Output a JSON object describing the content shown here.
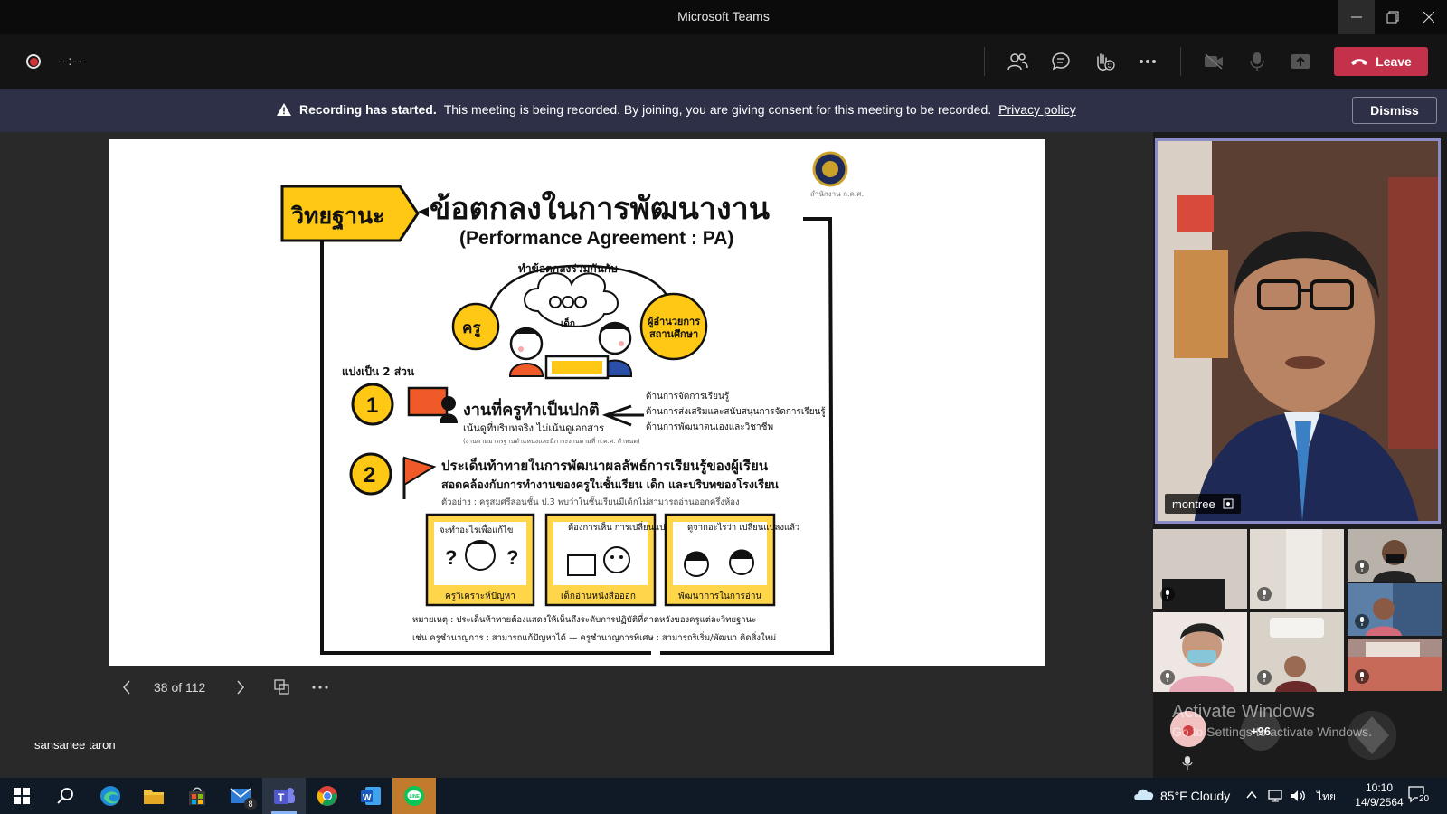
{
  "window": {
    "title": "Microsoft Teams"
  },
  "toolbar": {
    "timer": "--:--",
    "leave_label": "Leave"
  },
  "banner": {
    "title": "Recording has started.",
    "message": "This meeting is being recorded. By joining, you are giving consent for this meeting to be recorded.",
    "policy_link": "Privacy policy",
    "dismiss_label": "Dismiss"
  },
  "slide": {
    "counter": "38 of 112",
    "header_tag": "วิทยฐานะ",
    "title_th": "ข้อตกลงในการพัฒนางาน",
    "title_en": "(Performance Agreement : PA)",
    "agree_label": "ทำข้อตกลงร่วมกันกับ",
    "left_badge": "ครู",
    "child_label": "เด็ก",
    "right_badge_1": "ผู้อำนวยการ",
    "right_badge_2": "สถานศึกษา",
    "logo_caption": "สำนักงาน ก.ค.ศ.",
    "split_label": "แบ่งเป็น 2 ส่วน",
    "part1_number": "1",
    "part1_title": "งานที่ครูทำเป็นปกติ",
    "part1_sub": "เน้นดูที่บริบทจริง ไม่เน้นดูเอกสาร",
    "part1_note": "(งานตามมาตรฐานตำแหน่งและมีภาระงานตามที่ ก.ค.ศ. กำหนด)",
    "part1_items": [
      "ด้านการจัดการเรียนรู้",
      "ด้านการส่งเสริมและสนับสนุนการจัดการเรียนรู้",
      "ด้านการพัฒนาตนเองและวิชาชีพ"
    ],
    "part2_number": "2",
    "part2_line1": "ประเด็นท้าทายในการพัฒนาผลลัพธ์การเรียนรู้ของผู้เรียน",
    "part2_line2": "สอดคล้องกับการทำงานของครูในชั้นเรียน เด็ก และบริบทของโรงเรียน",
    "example": "ตัวอย่าง : ครูสมศรีสอนชั้น ป.3 พบว่าในชั้นเรียนมีเด็กไม่สามารถอ่านออกครึ่งห้อง",
    "cards": [
      {
        "top": "จะทำอะไรเพื่อแก้ไข",
        "bottom": "ครูวิเคราะห์ปัญหา"
      },
      {
        "top": "ต้องการเห็น การเปลี่ยนแปลงอะไร",
        "bottom": "เด็กอ่านหนังสือออก"
      },
      {
        "top": "ดูจากอะไรว่า เปลี่ยนแปลงแล้ว",
        "bottom": "พัฒนาการในการอ่าน"
      }
    ],
    "footnote1": "หมายเหตุ : ประเด็นท้าทายต้องแสดงให้เห็นถึงระดับการปฏิบัติที่คาดหวังของครูแต่ละวิทยฐานะ",
    "footnote2": "เช่น ครูชำนาญการ : สามารถแก้ปัญหาได้ — ครูชำนาญการพิเศษ : สามารถริเริ่ม/พัฒนา คิดสิ่งใหม่"
  },
  "presenter": {
    "name": "sansanee taron"
  },
  "main_video": {
    "name": "montree"
  },
  "participants": {
    "more_count": "+96"
  },
  "watermark": {
    "line1": "Activate Windows",
    "line2": "Go to Settings to activate Windows."
  },
  "taskbar": {
    "mail_badge": "8",
    "weather": "85°F  Cloudy",
    "lang": "ไทย",
    "time": "10:10",
    "date": "14/9/2564",
    "notif_count": "20"
  },
  "colors": {
    "accent": "#c4314b",
    "banner": "#2e3048",
    "slide_yellow": "#ffc814",
    "slide_orange": "#f05a28"
  }
}
